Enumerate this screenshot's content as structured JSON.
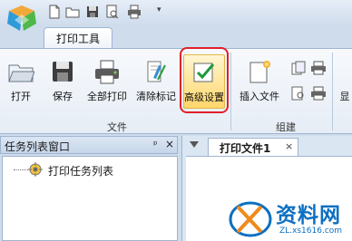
{
  "ribbon_tab": {
    "label": "打印工具"
  },
  "buttons": {
    "open": "打开",
    "save": "保存",
    "print_all": "全部打印",
    "clear_marks": "清除标记",
    "advanced": "高级设置",
    "insert_file": "插入文件",
    "display": "显"
  },
  "groups": {
    "file": "文件",
    "build": "组建"
  },
  "task_panel": {
    "title": "任务列表窗口",
    "pin": "ᵖ",
    "close": "×",
    "tree_item": "打印任务列表"
  },
  "doc_tab": {
    "label": "打印文件1",
    "close": "×"
  },
  "watermark": {
    "text": "资料网",
    "url": "ZL.xs1616.com"
  },
  "colors": {
    "accent": "#e0202a",
    "active_fill": "#ffd66b",
    "brand": "#0c6fc2"
  }
}
